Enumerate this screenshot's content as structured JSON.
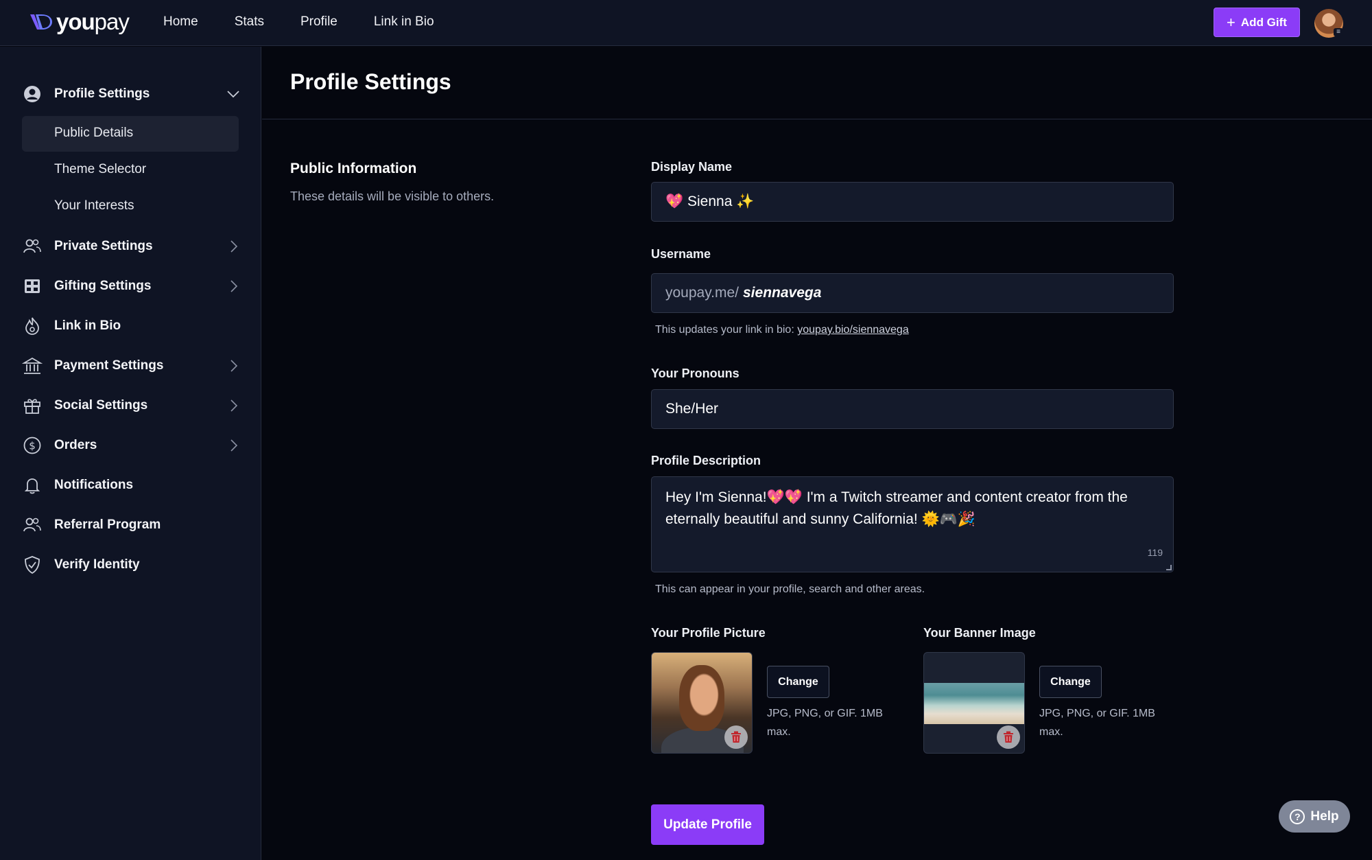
{
  "app": {
    "logo_bold": "you",
    "logo_light": "pay",
    "nav": [
      "Home",
      "Stats",
      "Profile",
      "Link in Bio"
    ],
    "add_gift_label": "Add Gift",
    "accent": "#8b3cf7"
  },
  "sidebar": {
    "profile_settings": {
      "label": "Profile Settings",
      "icon": "user-circle-icon",
      "subitems": [
        "Public Details",
        "Theme Selector",
        "Your Interests"
      ],
      "active": "Public Details"
    },
    "items": [
      {
        "label": "Private Settings",
        "icon": "users-icon",
        "chevron": true
      },
      {
        "label": "Gifting Settings",
        "icon": "gift-grid-icon",
        "chevron": true
      },
      {
        "label": "Link in Bio",
        "icon": "flame-icon",
        "chevron": false
      },
      {
        "label": "Payment Settings",
        "icon": "bank-icon",
        "chevron": true
      },
      {
        "label": "Social Settings",
        "icon": "gift-box-icon",
        "chevron": true
      },
      {
        "label": "Orders",
        "icon": "dollar-circle-icon",
        "chevron": true
      },
      {
        "label": "Notifications",
        "icon": "bell-icon",
        "chevron": false
      },
      {
        "label": "Referral Program",
        "icon": "users-icon",
        "chevron": false
      },
      {
        "label": "Verify Identity",
        "icon": "shield-check-icon",
        "chevron": false
      }
    ]
  },
  "main": {
    "page_title": "Profile Settings",
    "section_title": "Public Information",
    "section_desc": "These details will be visible to others.",
    "display_name": {
      "label": "Display Name",
      "value": "💖 Sienna ✨"
    },
    "username": {
      "label": "Username",
      "prefix": "youpay.me/",
      "value": "siennavega",
      "helper_text": "This updates your link in bio:",
      "helper_link": "youpay.bio/siennavega"
    },
    "pronouns": {
      "label": "Your Pronouns",
      "value": "She/Her"
    },
    "description": {
      "label": "Profile Description",
      "value": "Hey I'm Sienna!💖💖 I'm a Twitch streamer and content creator from the eternally beautiful and sunny California! 🌞🎮🎉",
      "count": "119",
      "helper": "This can appear in your profile, search and other areas."
    },
    "profile_picture": {
      "label": "Your Profile Picture",
      "change": "Change",
      "note": "JPG, PNG, or GIF. 1MB max."
    },
    "banner_image": {
      "label": "Your Banner Image",
      "change": "Change",
      "note": "JPG, PNG, or GIF. 1MB max."
    },
    "update_button": "Update Profile",
    "help_button": "Help"
  }
}
